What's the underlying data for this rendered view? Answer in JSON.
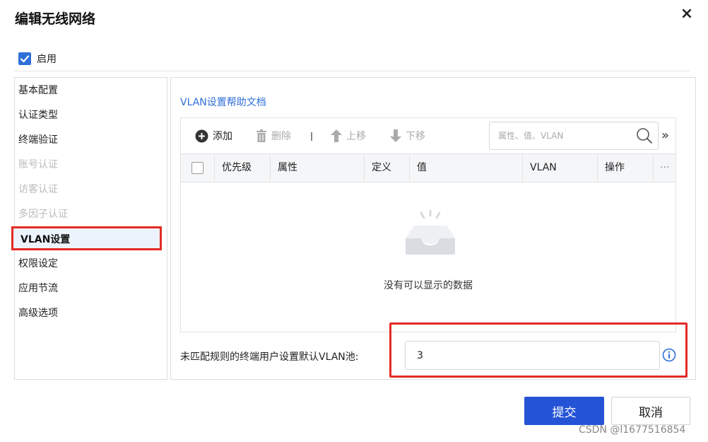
{
  "dialog": {
    "title": "编辑无线网络",
    "close_icon": "×",
    "enable_label": "启用",
    "enable_checked": true
  },
  "sidebar": {
    "items": [
      {
        "label": "基本配置",
        "state": "normal"
      },
      {
        "label": "认证类型",
        "state": "normal"
      },
      {
        "label": "终端验证",
        "state": "normal"
      },
      {
        "label": "账号认证",
        "state": "disabled"
      },
      {
        "label": "访客认证",
        "state": "disabled"
      },
      {
        "label": "多因子认证",
        "state": "disabled"
      },
      {
        "label": "VLAN设置",
        "state": "active"
      },
      {
        "label": "权限设定",
        "state": "normal"
      },
      {
        "label": "应用节流",
        "state": "normal"
      },
      {
        "label": "高级选项",
        "state": "normal"
      }
    ]
  },
  "main": {
    "help_link": "VLAN设置帮助文档",
    "toolbar": {
      "add": "添加",
      "delete": "删除",
      "move_up": "上移",
      "move_down": "下移",
      "search_placeholder": "属性、值、VLAN",
      "more": "»"
    },
    "table": {
      "columns": [
        "优先级",
        "属性",
        "定义",
        "值",
        "VLAN",
        "操作"
      ],
      "menu": "···",
      "rows": [],
      "empty_text": "没有可以显示的数据"
    },
    "default_vlan": {
      "label": "未匹配规则的终端用户设置默认VLAN池:",
      "value": "3"
    }
  },
  "footer": {
    "submit": "提交",
    "cancel": "取消"
  },
  "watermark": "CSDN @l1677516854",
  "colors": {
    "accent": "#2553d6",
    "link": "#2f6fd8",
    "highlight_border": "#e32b25",
    "active_bg": "#edf3fc"
  }
}
